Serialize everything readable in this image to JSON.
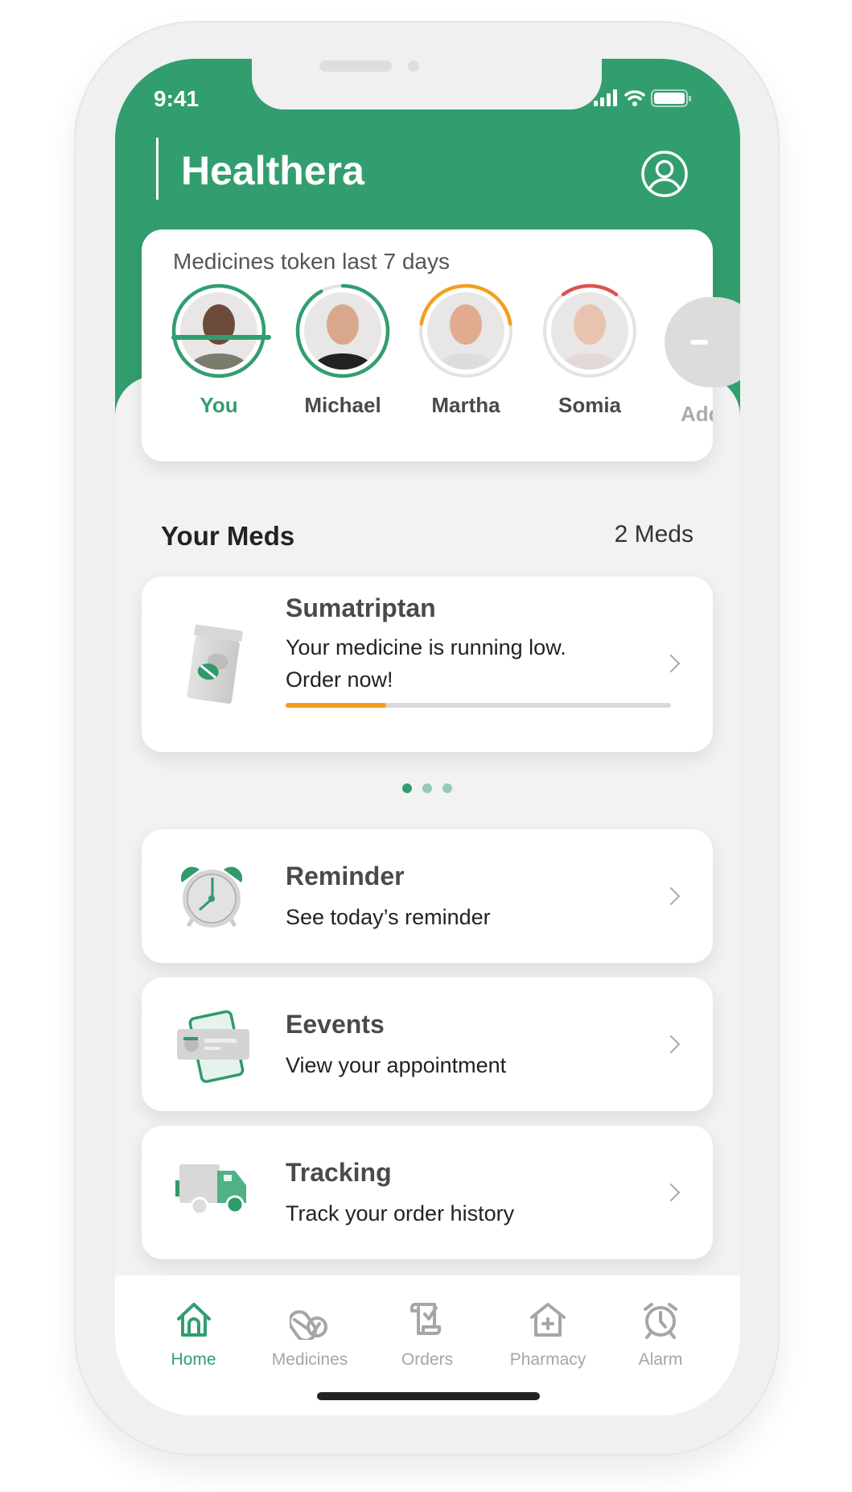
{
  "status_bar": {
    "time": "9:41"
  },
  "header": {
    "title": "Healthera",
    "profile_icon": "user-circle-icon"
  },
  "colors": {
    "brand": "#329e6f",
    "orange": "#f29f1b",
    "red": "#e0524f",
    "ring_track": "#e3e3e3"
  },
  "token_card": {
    "title": "Medicines token last 7 days",
    "people": [
      {
        "name": "You",
        "progress": 1.0,
        "ring_color": "#329e6f",
        "selected": true
      },
      {
        "name": "Michael",
        "progress": 0.92,
        "ring_color": "#329e6f"
      },
      {
        "name": "Martha",
        "progress": 0.45,
        "ring_color": "#f29f1b"
      },
      {
        "name": "Somia",
        "progress": 0.2,
        "ring_color": "#e0524f"
      }
    ],
    "add_label": "Add"
  },
  "meds": {
    "heading": "Your Meds",
    "count": "2 Meds",
    "card": {
      "name": "Sumatriptan",
      "line1": "Your medicine is running low.",
      "line2": "Order now!",
      "remaining": 0.26
    },
    "pager": {
      "pages": 3,
      "active": 0
    }
  },
  "actions": [
    {
      "title": "Reminder",
      "subtitle": "See today’s reminder",
      "icon": "alarm-clock-icon"
    },
    {
      "title": "Eevents",
      "subtitle": "View your appointment",
      "icon": "appointment-phone-icon"
    },
    {
      "title": "Tracking",
      "subtitle": "Track your order history",
      "icon": "delivery-truck-icon"
    }
  ],
  "tabbar": [
    {
      "label": "Home",
      "icon": "home-icon",
      "active": true
    },
    {
      "label": "Medicines",
      "icon": "pills-icon"
    },
    {
      "label": "Orders",
      "icon": "prescription-icon"
    },
    {
      "label": "Pharmacy",
      "icon": "pharmacy-icon"
    },
    {
      "label": "Alarm",
      "icon": "alarm-icon"
    }
  ]
}
